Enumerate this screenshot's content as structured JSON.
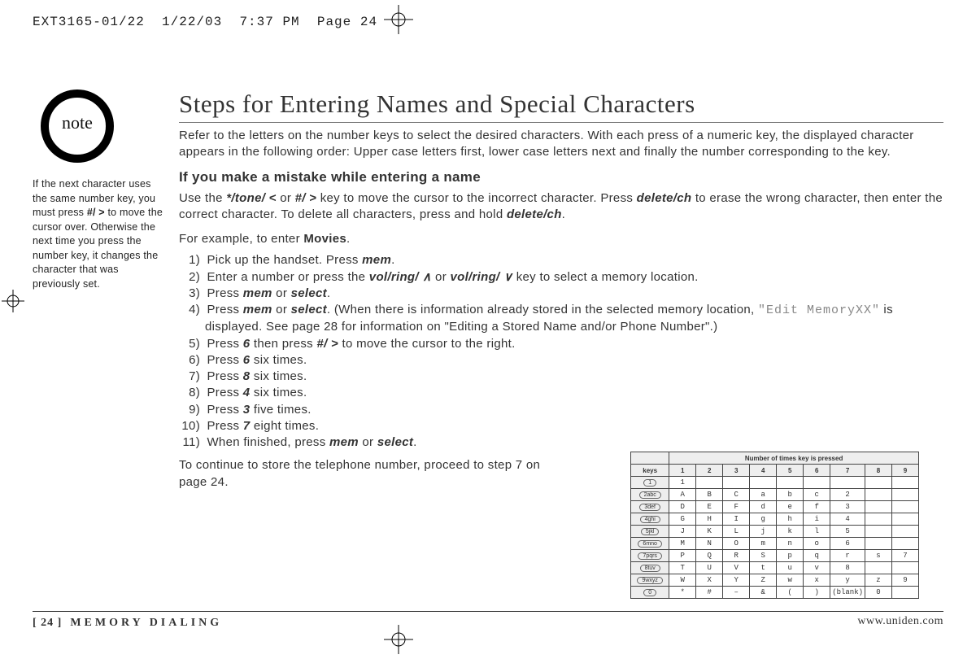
{
  "print_header": "EXT3165-01/22  1/22/03  7:37 PM  Page 24",
  "sidebar": {
    "note_label": "note",
    "note_text_parts": [
      "If the next character uses the same number key, you must press ",
      "#/ >",
      "  to move the cursor over. Otherwise the next time you press the number key, it changes the character that was previously set."
    ]
  },
  "title": "Steps for Entering Names and Special Characters",
  "intro": "Refer to the letters on the number keys to select the desired characters. With each press of a numeric key, the displayed character appears in the following order: Upper case letters first, lower case letters next and finally the number corresponding to the key.",
  "mistake_heading": "If you make a mistake while entering a name",
  "mistake_body_parts": [
    "Use the ",
    "*/tone/ <",
    " or ",
    "#/ >",
    " key to move the cursor to the incorrect character. Press ",
    "delete/ch",
    " to erase the wrong character, then enter the correct character. To delete all characters, press and hold ",
    "delete/ch",
    "."
  ],
  "example_intro_parts": [
    "For example, to enter ",
    "Movies",
    "."
  ],
  "steps": [
    {
      "num": "1)",
      "html": "Pick up the handset. Press <b class='emph'>mem</b>."
    },
    {
      "num": "2)",
      "html": "Enter a number or press the <b class='emph'>vol/ring/ ∧</b>  or <b class='emph'>vol/ring/ ∨</b> key to select a memory location."
    },
    {
      "num": "3)",
      "html": "Press <b class='emph'>mem</b> or <b class='emph'>select</b>."
    },
    {
      "num": "4)",
      "html": "Press <b class='emph'>mem</b> or <b class='emph'>select</b>. (When there is information already stored in the selected memory location, <span class='lcd'>\"Edit MemoryXX\"</span> is displayed. See page 28 for information on \"Editing a Stored Name and/or Phone Number\".)"
    },
    {
      "num": "5)",
      "html": "Press <b class='emph'>6</b> then press <b class='emph'>#/ ></b> to move the cursor to the right."
    },
    {
      "num": "6)",
      "html": "Press <b class='emph'>6</b> six times."
    },
    {
      "num": "7)",
      "html": "Press <b class='emph'>8</b> six times."
    },
    {
      "num": "8)",
      "html": "Press <b class='emph'>4</b> six times."
    },
    {
      "num": "9)",
      "html": "Press <b class='emph'>3</b> five times."
    },
    {
      "num": "10)",
      "html": "Press <b class='emph'>7</b> eight times."
    },
    {
      "num": "11)",
      "html": "When finished, press <b class='emph'>mem</b> or <b class='emph'>select</b>."
    }
  ],
  "continue_text": "To continue to store the telephone number, proceed to step 7 on page 24.",
  "footer": {
    "page": "[ 24 ]",
    "section": "MEMORY DIALING",
    "url": "www.uniden.com"
  },
  "chart_data": {
    "type": "table",
    "title": "Number of times key is pressed",
    "columns": [
      "keys",
      "1",
      "2",
      "3",
      "4",
      "5",
      "6",
      "7",
      "8",
      "9"
    ],
    "rows": [
      {
        "key": "1",
        "cells": [
          "1",
          "",
          "",
          "",
          "",
          "",
          "",
          "",
          ""
        ]
      },
      {
        "key": "2abc",
        "cells": [
          "A",
          "B",
          "C",
          "a",
          "b",
          "c",
          "2",
          "",
          ""
        ]
      },
      {
        "key": "3def",
        "cells": [
          "D",
          "E",
          "F",
          "d",
          "e",
          "f",
          "3",
          "",
          ""
        ]
      },
      {
        "key": "4ghi",
        "cells": [
          "G",
          "H",
          "I",
          "g",
          "h",
          "i",
          "4",
          "",
          ""
        ]
      },
      {
        "key": "5jkl",
        "cells": [
          "J",
          "K",
          "L",
          "j",
          "k",
          "l",
          "5",
          "",
          ""
        ]
      },
      {
        "key": "6mno",
        "cells": [
          "M",
          "N",
          "O",
          "m",
          "n",
          "o",
          "6",
          "",
          ""
        ]
      },
      {
        "key": "7pqrs",
        "cells": [
          "P",
          "Q",
          "R",
          "S",
          "p",
          "q",
          "r",
          "s",
          "7"
        ]
      },
      {
        "key": "8tuv",
        "cells": [
          "T",
          "U",
          "V",
          "t",
          "u",
          "v",
          "8",
          "",
          ""
        ]
      },
      {
        "key": "9wxyz",
        "cells": [
          "W",
          "X",
          "Y",
          "Z",
          "w",
          "x",
          "y",
          "z",
          "9"
        ]
      },
      {
        "key": "0",
        "cells": [
          "*",
          "#",
          "–",
          "&",
          "(",
          ")",
          "(blank)",
          "0",
          ""
        ]
      }
    ]
  }
}
